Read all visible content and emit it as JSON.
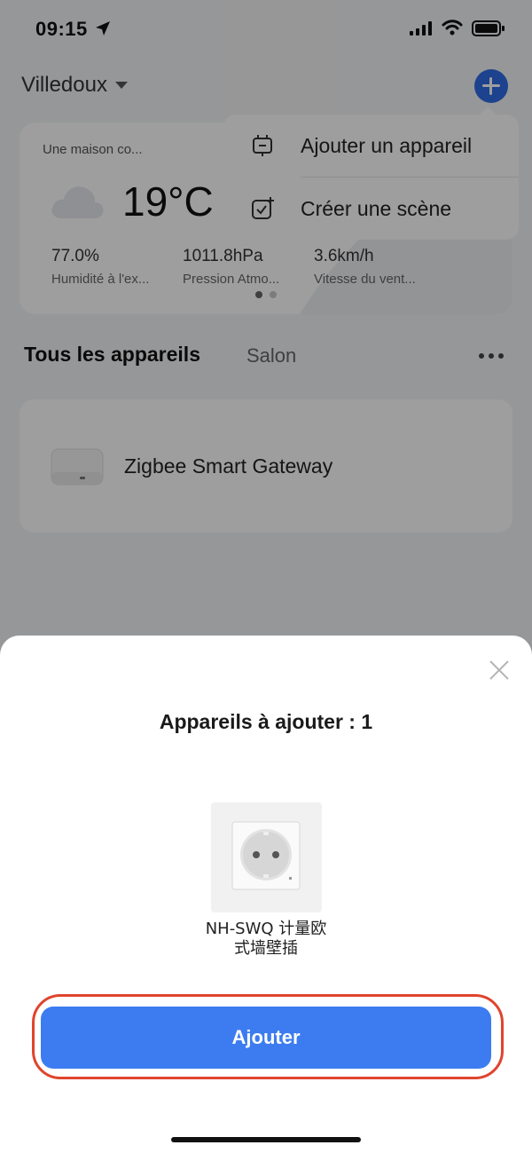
{
  "status_bar": {
    "time": "09:15"
  },
  "header": {
    "home_name": "Villedoux"
  },
  "weather": {
    "house_label": "Une maison co...",
    "temperature": "19°C",
    "metrics": [
      {
        "value": "77.0%",
        "label": "Humidité à l'ex..."
      },
      {
        "value": "1011.8hPa",
        "label": "Pression Atmo..."
      },
      {
        "value": "3.6km/h",
        "label": "Vitesse du vent..."
      }
    ]
  },
  "popover_menu": {
    "items": [
      {
        "label": "Ajouter un appareil",
        "icon": "add-device-icon"
      },
      {
        "label": "Créer une scène",
        "icon": "create-scene-icon"
      }
    ]
  },
  "tabs": {
    "all": "Tous les appareils",
    "salon": "Salon"
  },
  "devices": [
    {
      "name": "Zigbee Smart Gateway",
      "icon": "gateway-icon"
    }
  ],
  "bottom_sheet": {
    "title": "Appareils à ajouter : 1",
    "product_name_line1": "NH-SWQ 计量欧",
    "product_name_line2": "式墙壁插",
    "add_button_label": "Ajouter"
  },
  "colors": {
    "accent": "#3c7cf0",
    "highlight": "#e0442d"
  }
}
